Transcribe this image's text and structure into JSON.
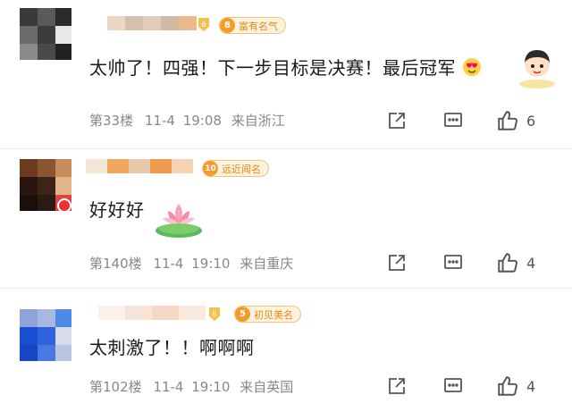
{
  "comments": [
    {
      "level": "6",
      "badge_level": "8",
      "badge_text": "富有名气",
      "text": "太帅了！四强！下一步目标是决赛！最后冠军",
      "emoji": "heart-eyes-emoji",
      "sticker": "cartoon-boy-sticker",
      "floor": "第33楼",
      "date": "11-4",
      "time": "19:08",
      "location": "来自浙江",
      "likes": "6"
    },
    {
      "level": "",
      "badge_level": "10",
      "badge_text": "远近闻名",
      "text": "好好好",
      "emoji": "lotus-emoji",
      "floor": "第140楼",
      "date": "11-4",
      "time": "19:10",
      "location": "来自重庆",
      "likes": "4"
    },
    {
      "level": "6",
      "badge_level": "5",
      "badge_text": "初见美名",
      "text": "太刺激了！！啊啊啊",
      "floor": "第102楼",
      "date": "11-4",
      "time": "19:10",
      "location": "来自英国",
      "likes": "4"
    }
  ],
  "icons": {
    "share": "share-icon",
    "comment": "comment-icon",
    "like": "thumbs-up-icon"
  },
  "colors": {
    "badge_orange": "#f39b2b",
    "meta_gray": "#888888",
    "text": "#1a1a1a"
  }
}
